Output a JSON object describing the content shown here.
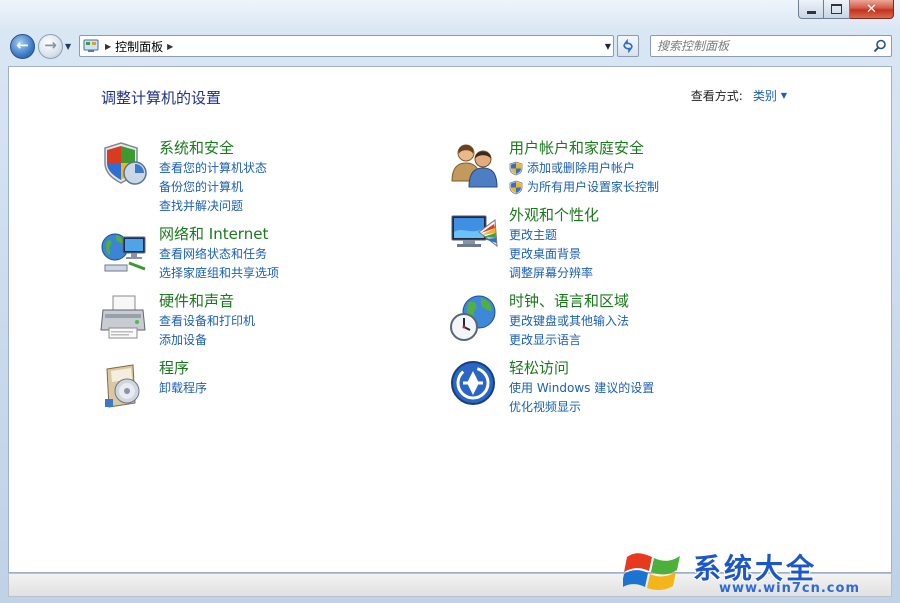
{
  "window": {
    "controls": [
      "minimize",
      "maximize",
      "close"
    ]
  },
  "nav": {
    "address": "控制面板",
    "search_placeholder": "搜索控制面板"
  },
  "main": {
    "title": "调整计算机的设置",
    "view_by_label": "查看方式:",
    "view_by_value": "类别"
  },
  "categories": [
    {
      "title": "系统和安全",
      "icon": "shield-icon",
      "links": [
        "查看您的计算机状态",
        "备份您的计算机",
        "查找并解决问题"
      ]
    },
    {
      "title": "用户帐户和家庭安全",
      "icon": "users-icon",
      "links": [
        "添加或删除用户帐户",
        "为所有用户设置家长控制"
      ]
    },
    {
      "title": "网络和 Internet",
      "icon": "network-icon",
      "links": [
        "查看网络状态和任务",
        "选择家庭组和共享选项"
      ]
    },
    {
      "title": "外观和个性化",
      "icon": "appearance-icon",
      "links": [
        "更改主题",
        "更改桌面背景",
        "调整屏幕分辨率"
      ]
    },
    {
      "title": "硬件和声音",
      "icon": "printer-icon",
      "links": [
        "查看设备和打印机",
        "添加设备"
      ]
    },
    {
      "title": "时钟、语言和区域",
      "icon": "globe-clock-icon",
      "links": [
        "更改键盘或其他输入法",
        "更改显示语言"
      ]
    },
    {
      "title": "程序",
      "icon": "programs-icon",
      "links": [
        "卸载程序"
      ]
    },
    {
      "title": "轻松访问",
      "icon": "ease-of-access-icon",
      "links": [
        "使用 Windows 建议的设置",
        "优化视频显示"
      ]
    }
  ],
  "watermark": {
    "title": "系统大全",
    "url": "www.win7cn.com"
  }
}
